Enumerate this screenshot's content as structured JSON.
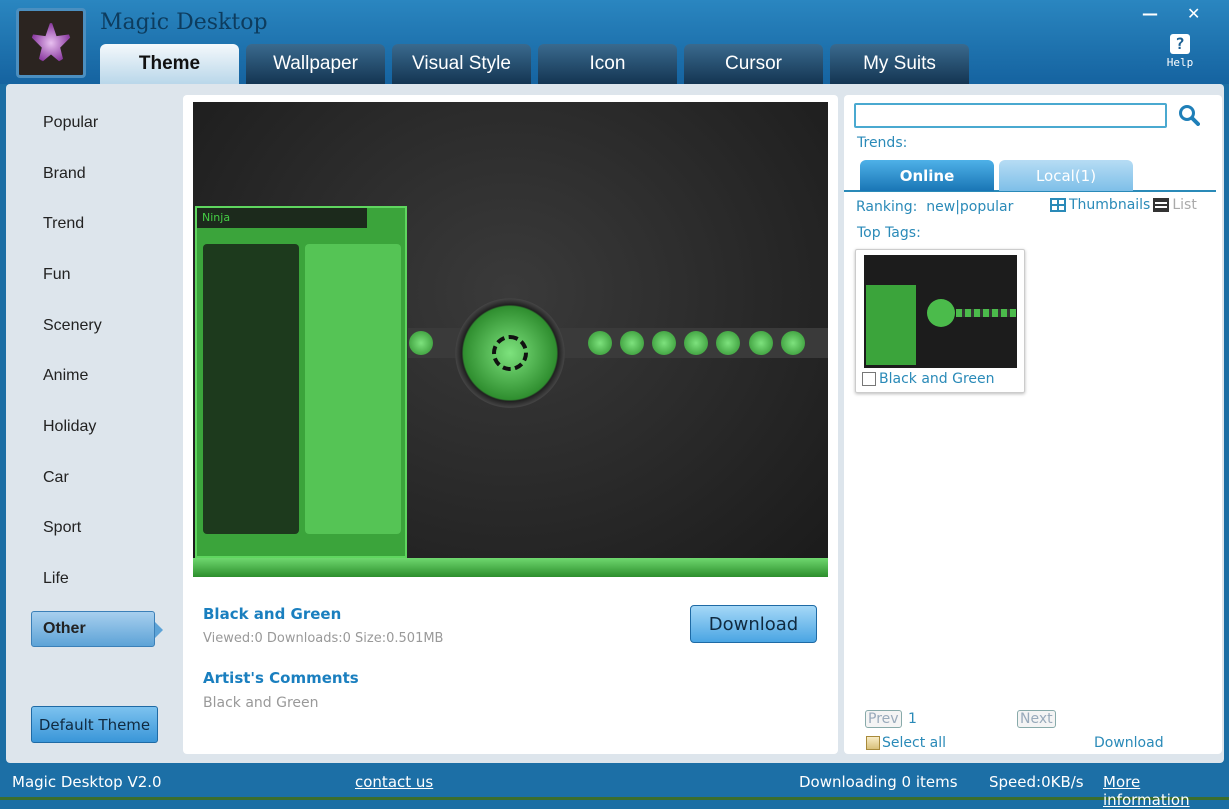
{
  "app": {
    "title": "Magic Desktop",
    "help_label": "Help",
    "minimize": "—",
    "close": "✕"
  },
  "tabs": [
    {
      "label": "Theme",
      "active": true
    },
    {
      "label": "Wallpaper"
    },
    {
      "label": "Visual Style"
    },
    {
      "label": "Icon"
    },
    {
      "label": "Cursor"
    },
    {
      "label": "My Suits"
    }
  ],
  "sidebar": {
    "items": [
      {
        "label": "Popular"
      },
      {
        "label": "Brand"
      },
      {
        "label": "Trend"
      },
      {
        "label": "Fun"
      },
      {
        "label": "Scenery"
      },
      {
        "label": "Anime"
      },
      {
        "label": "Holiday"
      },
      {
        "label": "Car"
      },
      {
        "label": "Sport"
      },
      {
        "label": "Life"
      },
      {
        "label": "Other",
        "active": true
      }
    ],
    "default_theme_label": "Default Theme"
  },
  "preview": {
    "menu_user": "Ninja",
    "theme_name": "Black and Green",
    "meta": "Viewed:0 Downloads:0 Size:0.501MB",
    "download_label": "Download",
    "comments_title": "Artist's Comments",
    "comments": "Black and Green"
  },
  "right": {
    "search_value": "",
    "trends_label": "Trends:",
    "tabs": [
      {
        "label": "Online",
        "active": true
      },
      {
        "label": "Local(1)"
      }
    ],
    "ranking_label": "Ranking:",
    "ranking_new": "new",
    "ranking_sep": "|",
    "ranking_popular": "popular",
    "thumbnails_label": "Thumbnails",
    "list_label": "List",
    "top_tags_label": "Top Tags:",
    "items": [
      {
        "name": "Black and Green",
        "checked": false
      }
    ],
    "prev_label": "Prev",
    "page": "1",
    "next_label": "Next",
    "select_all_label": "Select all",
    "download_label": "Download"
  },
  "status": {
    "version": "Magic Desktop V2.0",
    "contact": "contact us",
    "downloading": "Downloading 0 items",
    "speed": "Speed:0KB/s",
    "more": "More information"
  },
  "colors": {
    "accent": "#1a7fbf",
    "titlebar": "#1563a0",
    "preview_green": "#3ba43b"
  }
}
